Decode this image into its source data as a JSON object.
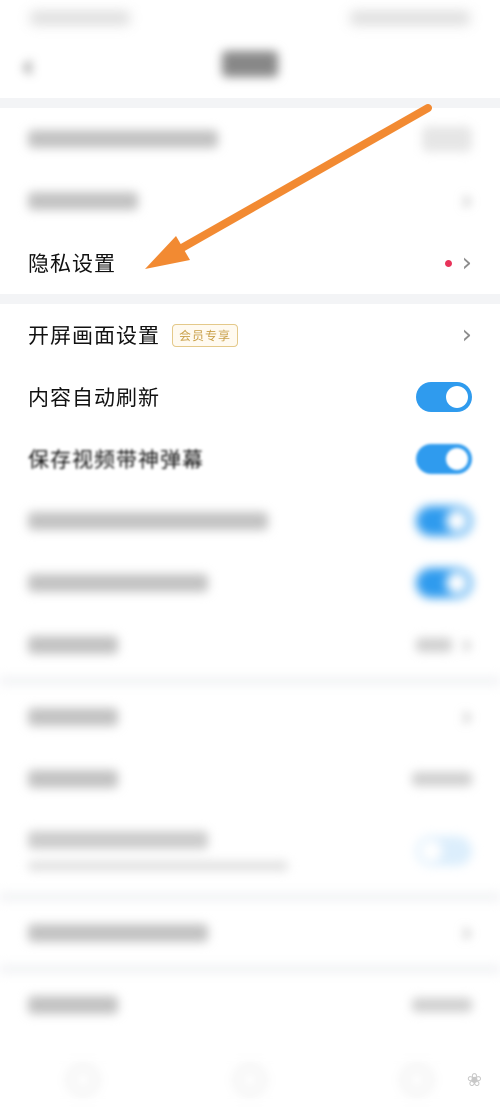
{
  "nav": {
    "back_icon": "chevron-left-icon"
  },
  "rows": {
    "privacy": {
      "label": "隐私设置",
      "dot_color": "#e8335a"
    },
    "splash": {
      "label": "开屏画面设置",
      "badge": "会员专享"
    },
    "auto_refresh": {
      "label": "内容自动刷新",
      "enabled": true
    },
    "save_danmaku": {
      "label": "保存视频带神弹幕",
      "enabled": true
    }
  },
  "colors": {
    "toggle_on": "#2f9bee",
    "annotation_arrow": "#f28a32",
    "badge_text": "#c9a04a"
  }
}
